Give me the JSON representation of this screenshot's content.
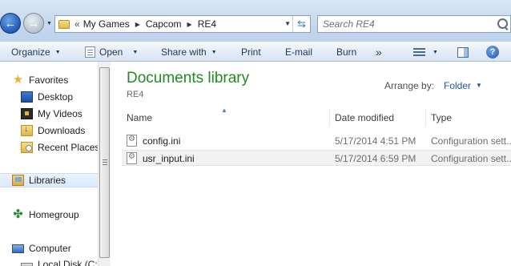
{
  "window": {
    "address": {
      "overflow": "«",
      "crumbs": [
        "My Games",
        "Capcom",
        "RE4"
      ]
    },
    "search": {
      "placeholder": "Search RE4"
    }
  },
  "command_bar": {
    "organize": "Organize",
    "open": "Open",
    "share_with": "Share with",
    "print": "Print",
    "email": "E-mail",
    "burn": "Burn",
    "more": "»"
  },
  "nav_pane": {
    "favorites": "Favorites",
    "desktop": "Desktop",
    "my_videos": "My Videos",
    "downloads": "Downloads",
    "recent_places": "Recent Places",
    "libraries": "Libraries",
    "homegroup": "Homegroup",
    "computer": "Computer",
    "local_disk": "Local Disk (C:)"
  },
  "content": {
    "title": "Documents library",
    "subtitle": "RE4",
    "arrange_label": "Arrange by:",
    "arrange_value": "Folder",
    "columns": [
      "Name",
      "Date modified",
      "Type"
    ],
    "files": [
      {
        "name": "config.ini",
        "date": "5/17/2014 4:51 PM",
        "type": "Configuration sett..."
      },
      {
        "name": "usr_input.ini",
        "date": "5/17/2014 6:59 PM",
        "type": "Configuration sett..."
      }
    ]
  }
}
